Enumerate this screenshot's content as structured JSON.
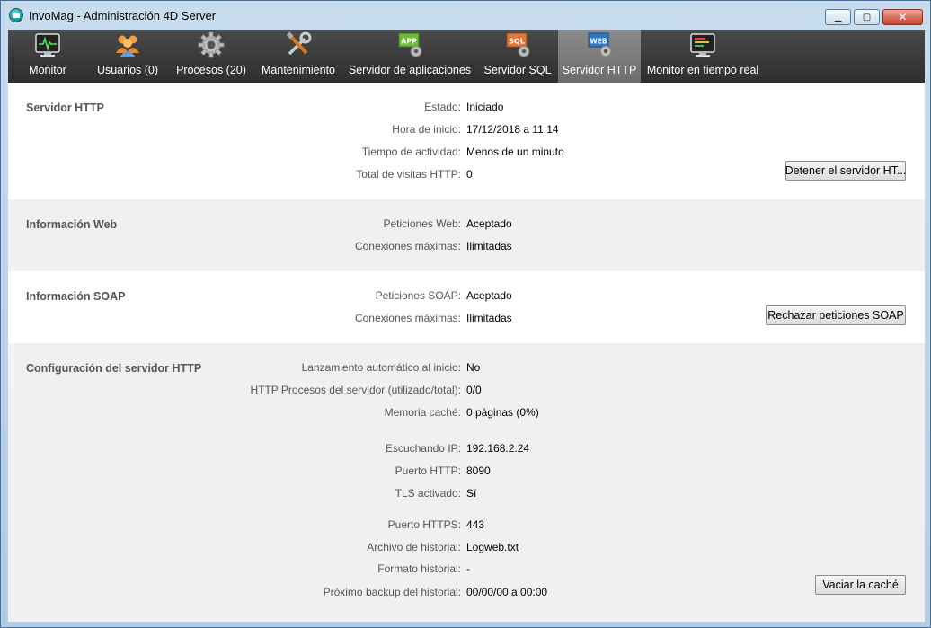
{
  "window": {
    "title": "InvoMag - Administración 4D Server",
    "controls": {
      "minimize": "▁",
      "maximize": "▢",
      "close": "✕"
    }
  },
  "toolbar": {
    "items": [
      {
        "label": "Monitor",
        "icon": "monitor-icon"
      },
      {
        "label": "Usuarios (0)",
        "icon": "users-icon"
      },
      {
        "label": "Procesos (20)",
        "icon": "gear-icon"
      },
      {
        "label": "Mantenimiento",
        "icon": "tools-icon"
      },
      {
        "label": "Servidor de aplicaciones",
        "icon": "app-server-icon",
        "badge": "APP"
      },
      {
        "label": "Servidor SQL",
        "icon": "sql-server-icon",
        "badge": "SQL"
      },
      {
        "label": "Servidor HTTP",
        "icon": "web-server-icon",
        "badge": "WEB",
        "active": true
      },
      {
        "label": "Monitor en tiempo real",
        "icon": "realtime-monitor-icon"
      }
    ]
  },
  "sections": {
    "http": {
      "title": "Servidor HTTP",
      "rows": [
        {
          "label": "Estado:",
          "value": "Iniciado"
        },
        {
          "label": "Hora de inicio:",
          "value": "17/12/2018 a 11:14"
        },
        {
          "label": "Tiempo de actividad:",
          "value": "Menos de un minuto"
        },
        {
          "label": "Total de visitas HTTP:",
          "value": "0"
        }
      ],
      "button": "Detener el servidor HT..."
    },
    "web": {
      "title": "Información Web",
      "rows": [
        {
          "label": "Peticiones Web:",
          "value": "Aceptado"
        },
        {
          "label": "Conexiones máximas:",
          "value": "Ilimitadas"
        }
      ]
    },
    "soap": {
      "title": "Información SOAP",
      "rows": [
        {
          "label": "Peticiones SOAP:",
          "value": "Aceptado"
        },
        {
          "label": "Conexiones máximas:",
          "value": "Ilimitadas"
        }
      ],
      "button": "Rechazar peticiones SOAP"
    },
    "config": {
      "title": "Configuración del servidor HTTP",
      "rows": [
        {
          "label": "Lanzamiento automático al inicio:",
          "value": "No"
        },
        {
          "label": "HTTP Procesos del servidor (utilizado/total):",
          "value": "0/0"
        },
        {
          "label": "Memoria caché:",
          "value": "0 páginas (0%)"
        },
        {
          "label": "Escuchando IP:",
          "value": "192.168.2.24"
        },
        {
          "label": "Puerto HTTP:",
          "value": "8090"
        },
        {
          "label": "TLS activado:",
          "value": "Sí"
        },
        {
          "label": "Puerto HTTPS:",
          "value": "443"
        },
        {
          "label": "Archivo de historial:",
          "value": "Logweb.txt"
        },
        {
          "label": "Formato historial:",
          "value": "-"
        },
        {
          "label": "Próximo backup del historial:",
          "value": "00/00/00 a 00:00"
        }
      ],
      "button": "Vaciar la caché"
    }
  }
}
